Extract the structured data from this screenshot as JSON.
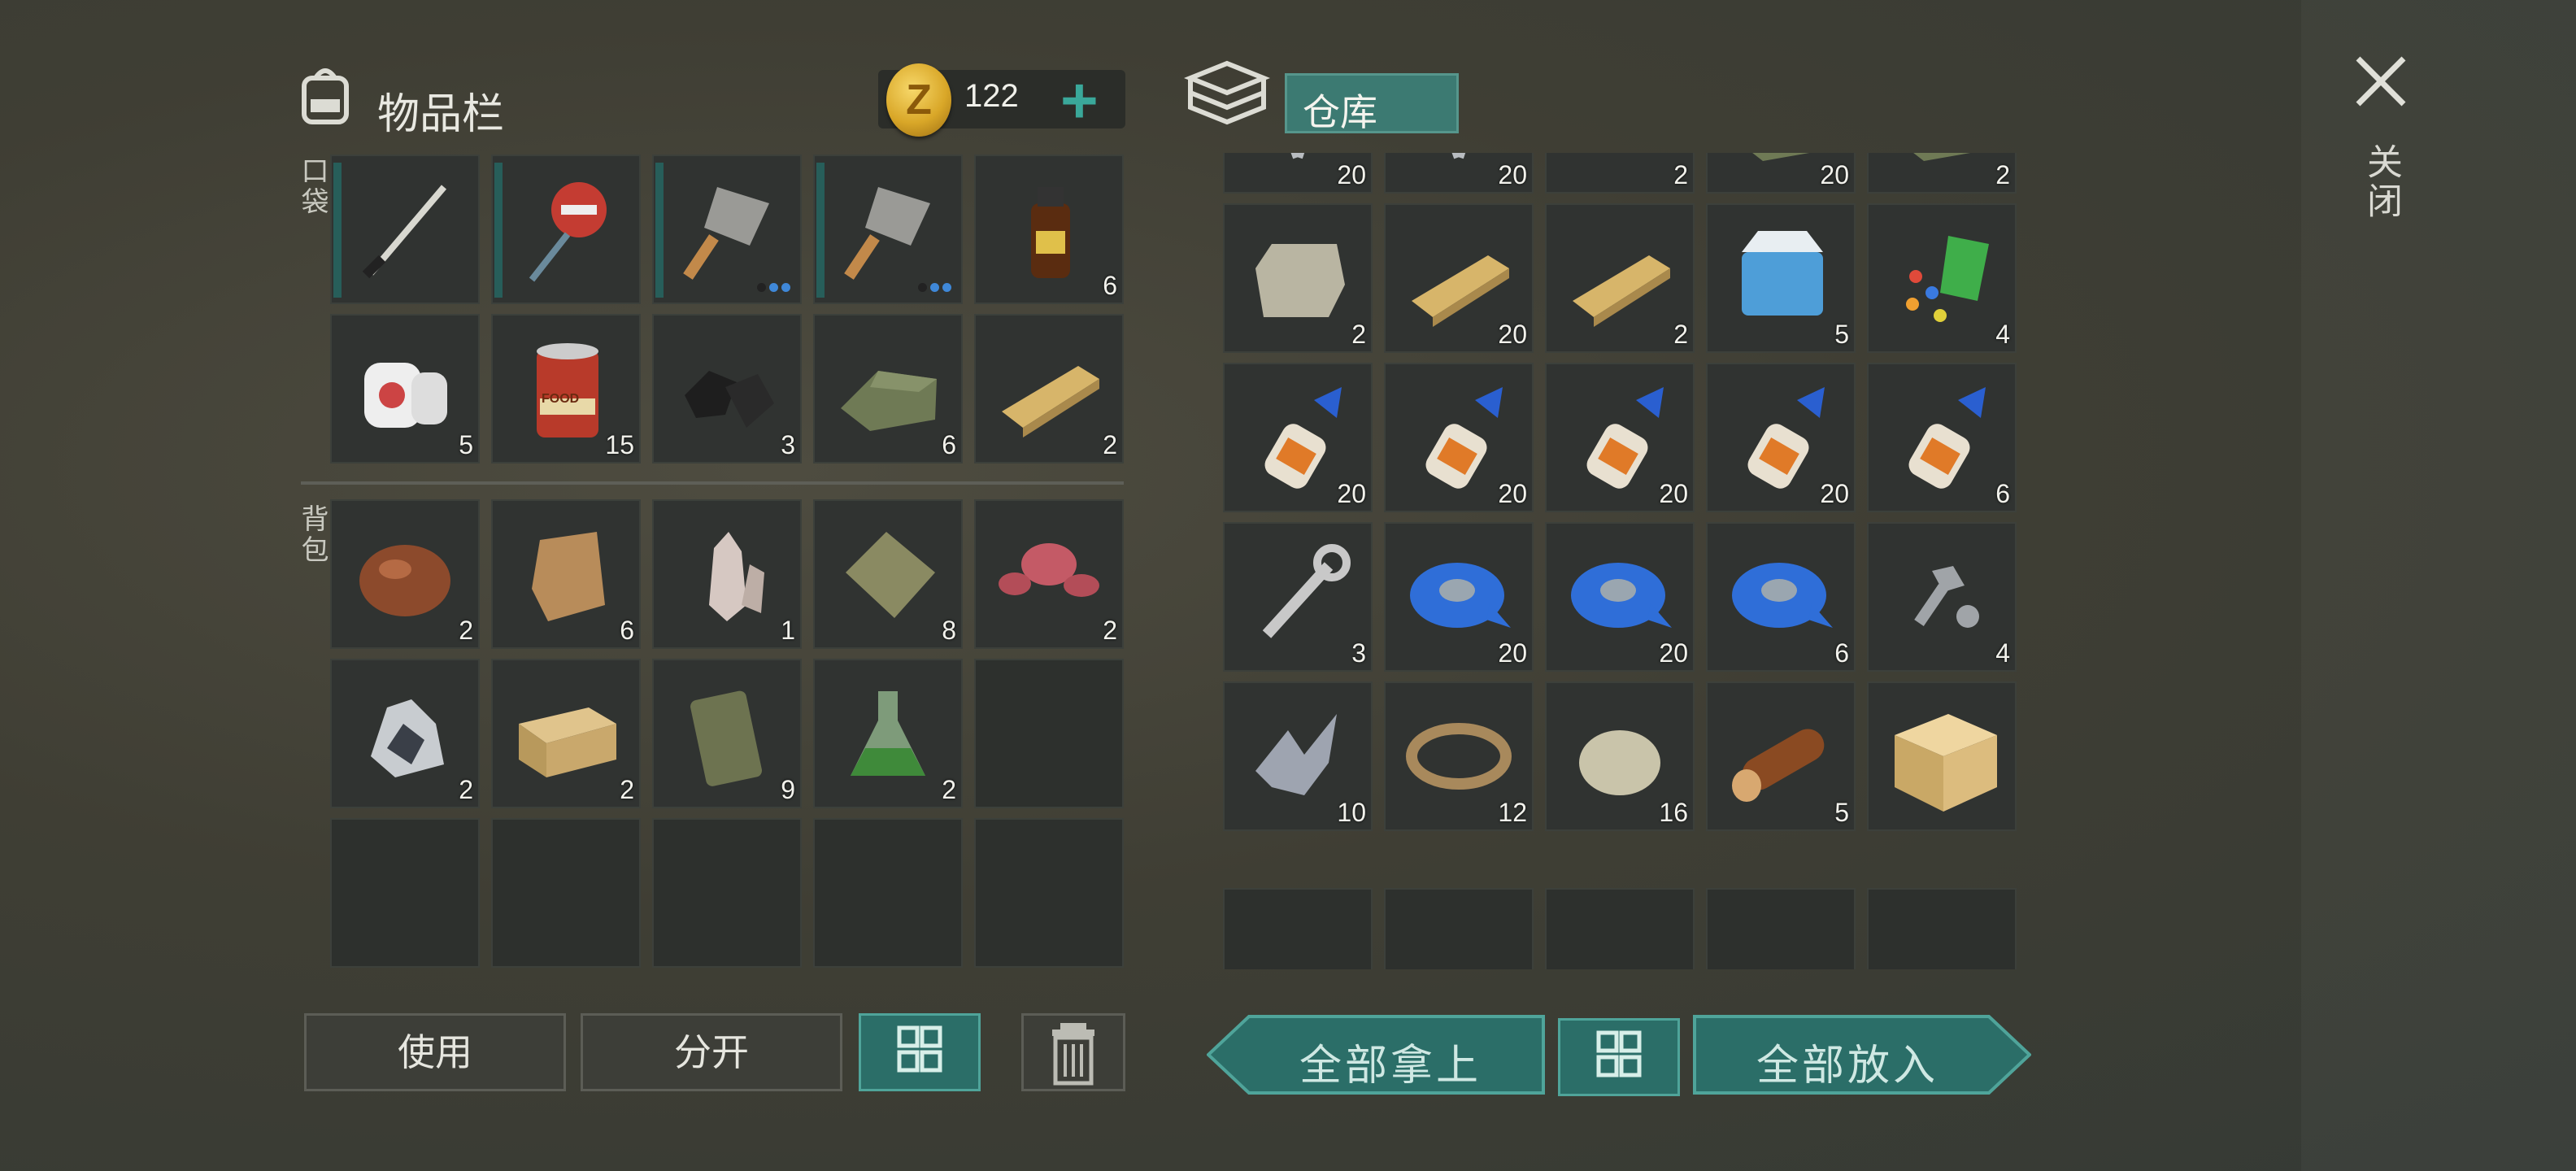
{
  "inventory": {
    "title": "物品栏",
    "coins": "122",
    "coin_symbol": "Z",
    "pocket_label": "口袋",
    "backpack_label": "背包",
    "pocket_slots": [
      {
        "icon": "katana-icon",
        "count": "",
        "durability": true
      },
      {
        "icon": "stop-sign-icon",
        "count": "",
        "durability": true
      },
      {
        "icon": "cleaver-icon",
        "count": "",
        "durability": true,
        "dots": 2
      },
      {
        "icon": "cleaver-icon",
        "count": "",
        "durability": true,
        "dots": 2
      },
      {
        "icon": "medicine-bottle-icon",
        "count": "6"
      },
      {
        "icon": "bandage-icon",
        "count": "5"
      },
      {
        "icon": "canned-food-icon",
        "count": "15",
        "label": "FOOD"
      },
      {
        "icon": "coal-icon",
        "count": "3"
      },
      {
        "icon": "cloth-icon",
        "count": "6"
      },
      {
        "icon": "plank-icon",
        "count": "2"
      }
    ],
    "backpack_slots": [
      {
        "icon": "copper-ore-icon",
        "count": "2"
      },
      {
        "icon": "fur-icon",
        "count": "6"
      },
      {
        "icon": "crystal-icon",
        "count": "1"
      },
      {
        "icon": "burlap-icon",
        "count": "8"
      },
      {
        "icon": "mushroom-icon",
        "count": "2"
      },
      {
        "icon": "silver-ore-icon",
        "count": "2"
      },
      {
        "icon": "crate-icon",
        "count": "2"
      },
      {
        "icon": "jerrycan-icon",
        "count": "9"
      },
      {
        "icon": "flask-icon",
        "count": "2"
      },
      {
        "icon": "",
        "count": ""
      },
      {
        "icon": "",
        "count": ""
      },
      {
        "icon": "",
        "count": ""
      },
      {
        "icon": "",
        "count": ""
      },
      {
        "icon": "",
        "count": ""
      },
      {
        "icon": "",
        "count": ""
      }
    ]
  },
  "storage": {
    "title": "仓库",
    "slots": [
      {
        "icon": "nails-icon",
        "count": "20"
      },
      {
        "icon": "nails-icon",
        "count": "20"
      },
      {
        "icon": "iron-bar-icon",
        "count": "2"
      },
      {
        "icon": "cloth-icon",
        "count": "20"
      },
      {
        "icon": "cloth-icon",
        "count": "2"
      },
      {
        "icon": "stone-block-icon",
        "count": "2"
      },
      {
        "icon": "plank-icon",
        "count": "20"
      },
      {
        "icon": "plank-icon",
        "count": "2"
      },
      {
        "icon": "cooler-icon",
        "count": "5"
      },
      {
        "icon": "parts-icon",
        "count": "4"
      },
      {
        "icon": "glue-icon",
        "count": "20"
      },
      {
        "icon": "glue-icon",
        "count": "20"
      },
      {
        "icon": "glue-icon",
        "count": "20"
      },
      {
        "icon": "glue-icon",
        "count": "20"
      },
      {
        "icon": "glue-icon",
        "count": "6"
      },
      {
        "icon": "wrench-icon",
        "count": "3"
      },
      {
        "icon": "tape-icon",
        "count": "20"
      },
      {
        "icon": "tape-icon",
        "count": "20"
      },
      {
        "icon": "tape-icon",
        "count": "6"
      },
      {
        "icon": "bolt-icon",
        "count": "4"
      },
      {
        "icon": "scrap-metal-icon",
        "count": "10"
      },
      {
        "icon": "rope-icon",
        "count": "12"
      },
      {
        "icon": "stone-icon",
        "count": "16"
      },
      {
        "icon": "log-icon",
        "count": "5"
      },
      {
        "icon": "box-icon",
        "count": ""
      }
    ]
  },
  "buttons": {
    "use": "使用",
    "split": "分开",
    "take_all": "全部拿上",
    "put_all": "全部放入",
    "close": "关闭"
  },
  "colors": {
    "accent": "#3c7a72",
    "slot": "#2d302d",
    "background": "#3f3e34",
    "coin": "#d9a728",
    "glue_cap": "#2a5fd0",
    "tape": "#2f6ed8"
  }
}
